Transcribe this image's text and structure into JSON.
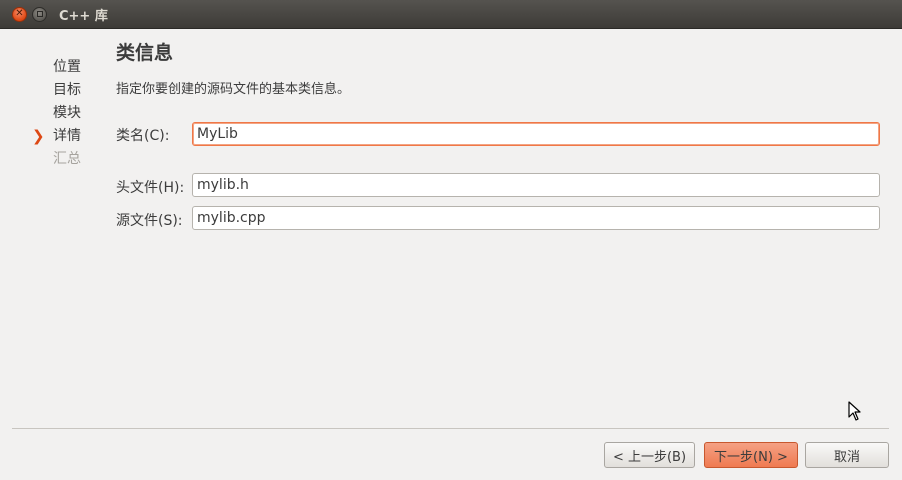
{
  "window": {
    "title": "C++ 库"
  },
  "steps": [
    {
      "label": "位置",
      "state": "done"
    },
    {
      "label": "目标",
      "state": "done"
    },
    {
      "label": "模块",
      "state": "done"
    },
    {
      "label": "详情",
      "state": "current"
    },
    {
      "label": "汇总",
      "state": "disabled"
    }
  ],
  "page": {
    "title": "类信息",
    "subtitle": "指定你要创建的源码文件的基本类信息。"
  },
  "fields": {
    "class_name": {
      "label": "类名(C):",
      "value": "MyLib"
    },
    "header_file": {
      "label": "头文件(H):",
      "value": "mylib.h"
    },
    "source_file": {
      "label": "源文件(S):",
      "value": "mylib.cpp"
    }
  },
  "buttons": {
    "back": "< 上一步(B)",
    "next": "下一步(N) >",
    "cancel": "取消"
  },
  "colors": {
    "accent": "#dd4814",
    "focus_border": "#f07746",
    "default_button": "#ef7a51"
  }
}
